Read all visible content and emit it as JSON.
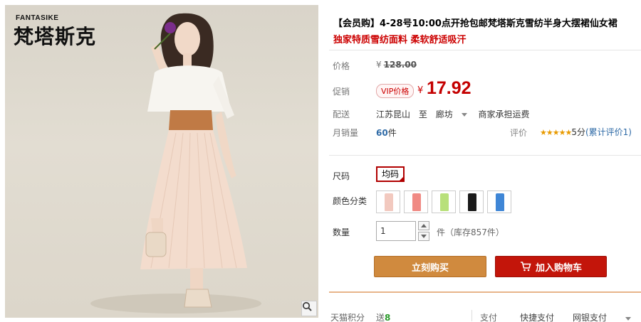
{
  "product_image": {
    "brand_en": "FANTASIKE",
    "brand_cn": "梵塔斯克",
    "zoom_icon": "magnifier-icon"
  },
  "product": {
    "title": "【会员购】4-28号10:00点开抢包邮梵塔斯克雪纺半身大摆裙仙女裙",
    "subtitle": "独家特质雪纺面料 柔软舒适吸汗"
  },
  "price": {
    "label": "价格",
    "currency": "¥",
    "original": "128.00",
    "promo_label": "促销",
    "vip_badge": "VIP价格",
    "vip_currency": "¥",
    "current": "17.92",
    "accent_color": "#c40000"
  },
  "shipping": {
    "label": "配送",
    "from": "江苏昆山",
    "to_word": "至",
    "destination": "廊坊",
    "fee_note": "商家承担运费"
  },
  "sales": {
    "label": "月销量",
    "count": "60",
    "unit": "件",
    "rating_label": "评价",
    "stars": "★★★★★",
    "score_text": "5分",
    "review_link": "(累计评价1)"
  },
  "options": {
    "size_label": "尺码",
    "size_value": "均码",
    "color_label": "颜色分类",
    "colors": [
      "#f2c9bf",
      "#f08a84",
      "#b8e07a",
      "#1a1a1a",
      "#3f86d6"
    ],
    "qty_label": "数量",
    "qty_value": "1",
    "stock_text": "件（库存857件）"
  },
  "actions": {
    "buy_now": "立刻购买",
    "add_cart": "加入购物车",
    "cart_icon": "shopping-cart-icon",
    "buy_color": "#d08a3e",
    "cart_color": "#c3150a"
  },
  "footer": {
    "points_label": "天猫积分",
    "points_prefix": "送",
    "points_value": "8",
    "pay_label": "支付",
    "pay_quick": "快捷支付",
    "pay_bank": "网银支付"
  }
}
